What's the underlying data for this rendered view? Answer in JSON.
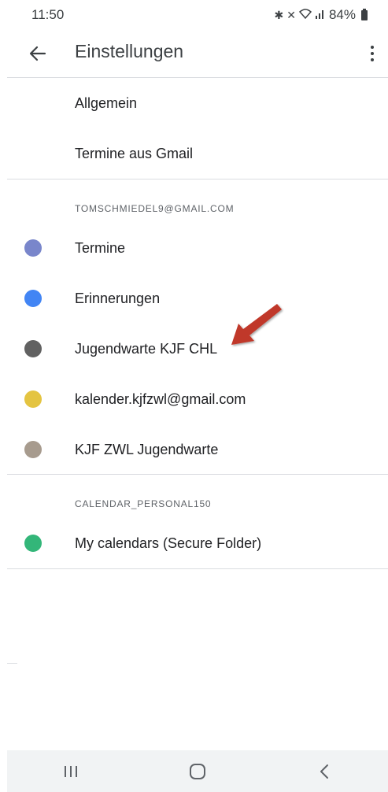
{
  "status": {
    "time": "11:50",
    "battery": "84%"
  },
  "app_bar": {
    "title": "Einstellungen"
  },
  "general": [
    {
      "label": "Allgemein"
    },
    {
      "label": "Termine aus Gmail"
    }
  ],
  "accounts": [
    {
      "header": "TOMSCHMIEDEL9@GMAIL.COM",
      "calendars": [
        {
          "label": "Termine",
          "color": "#7986cb"
        },
        {
          "label": "Erinnerungen",
          "color": "#4285f4"
        },
        {
          "label": "Jugendwarte KJF CHL",
          "color": "#616161"
        },
        {
          "label": "kalender.kjfzwl@gmail.com",
          "color": "#e4c441"
        },
        {
          "label": "KJF ZWL Jugendwarte",
          "color": "#a79b8e"
        }
      ]
    },
    {
      "header": "CALENDAR_PERSONAL150",
      "calendars": [
        {
          "label": "My calendars (Secure Folder)",
          "color": "#33b679"
        }
      ]
    }
  ],
  "annotation": {
    "color": "#c0392b"
  }
}
